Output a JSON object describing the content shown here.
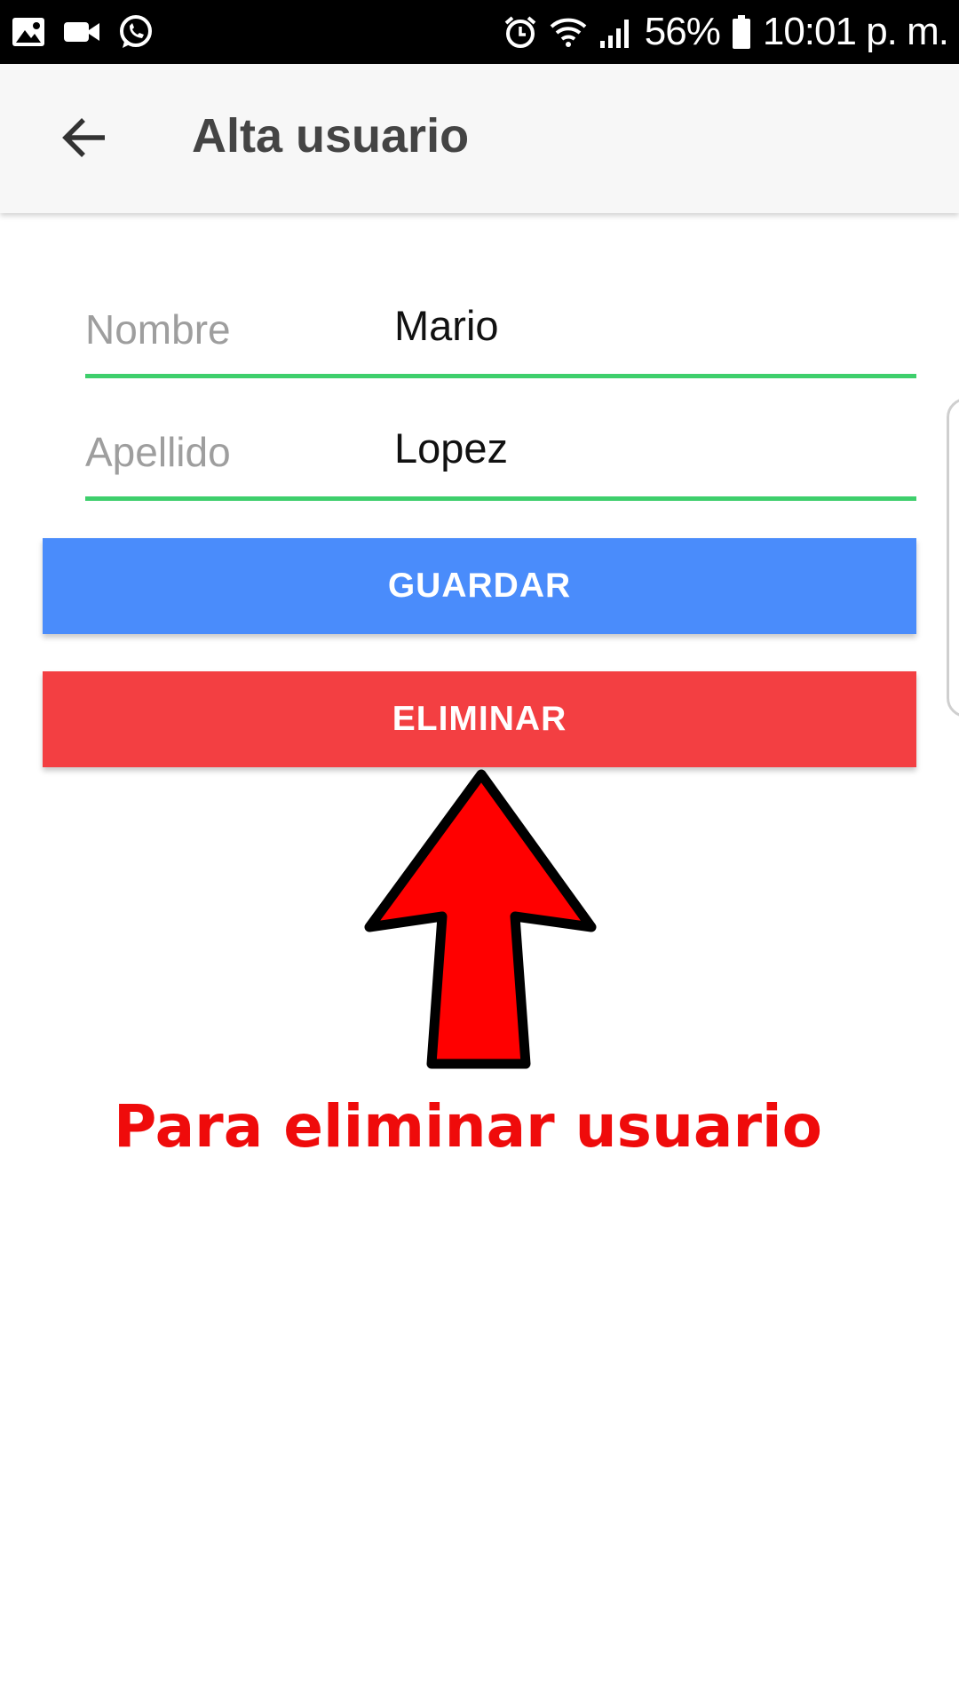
{
  "status_bar": {
    "left_icons": [
      "gallery-icon",
      "video-camera-icon",
      "whatsapp-icon"
    ],
    "right_icons": [
      "alarm-icon",
      "wifi-icon",
      "signal-icon",
      "battery-icon"
    ],
    "battery": "56%",
    "time": "10:01 p. m."
  },
  "app_bar": {
    "back_icon": "arrow-left-icon",
    "title": "Alta usuario"
  },
  "form": {
    "nombre": {
      "label": "Nombre",
      "value": "Mario"
    },
    "apellido": {
      "label": "Apellido",
      "value": "Lopez"
    }
  },
  "buttons": {
    "save_label": "GUARDAR",
    "delete_label": "ELIMINAR"
  },
  "annotation": {
    "text": "Para eliminar usuario",
    "arrow_icon": "arrow-up-icon"
  },
  "colors": {
    "status_bar": "#000000",
    "app_bar": "#f7f7f7",
    "field_underline": "#3ecf6c",
    "save_button": "#4a8cfb",
    "delete_button": "#f33f42",
    "annotation": "#ef0b0b"
  }
}
